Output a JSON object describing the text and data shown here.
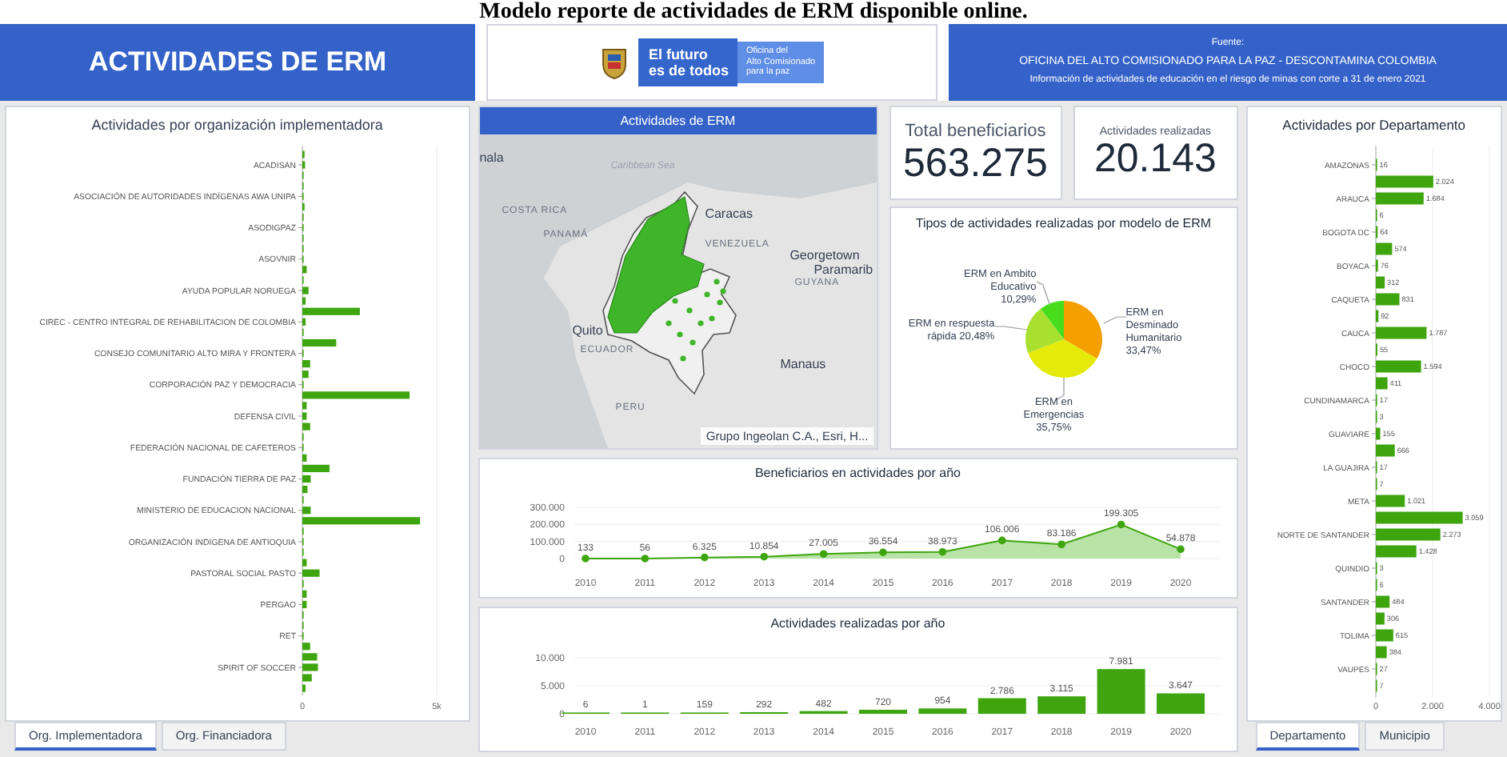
{
  "caption": "Modelo reporte de actividades de ERM disponible online.",
  "header": {
    "title": "ACTIVIDADES DE ERM",
    "logo_texts": [
      "El futuro\nes de todos",
      "Oficina del\nAlto Comisionado\npara la paz"
    ],
    "source": [
      "Fuente:",
      "OFICINA DEL ALTO COMISIONADO PARA LA PAZ - DESCONTAMINA COLOMBIA",
      "Información de actividades de educación en el riesgo de minas con corte a 31 de enero 2021"
    ]
  },
  "org_panel": {
    "title": "Actividades por organización implementadora",
    "chart_data": {
      "type": "bar",
      "orientation": "horizontal",
      "values": [
        80,
        100,
        40,
        40,
        40,
        80,
        20,
        40,
        20,
        20,
        20,
        160,
        20,
        230,
        120,
        2140,
        120,
        40,
        1260,
        40,
        290,
        230,
        40,
        3990,
        160,
        160,
        290,
        20,
        20,
        160,
        1010,
        310,
        190,
        20,
        310,
        4380,
        20,
        40,
        20,
        160,
        640,
        20,
        160,
        160,
        20,
        20,
        20,
        290,
        550,
        580,
        350,
        120
      ],
      "categories": [
        null,
        "ACADISAN",
        null,
        null,
        "ASOCIACIÓN DE AUTORIDADES INDÍGENAS AWA UNIPA",
        null,
        null,
        "ASODIGPAZ",
        null,
        null,
        "ASOVNIR",
        null,
        null,
        "AYUDA POPULAR NORUEGA",
        null,
        null,
        "CIREC - CENTRO INTEGRAL DE REHABILITACION DE COLOMBIA",
        null,
        null,
        "CONSEJO COMUNITARIO ALTO MIRA Y FRONTERA",
        null,
        null,
        "CORPORACIÓN PAZ Y DEMOCRACIA",
        null,
        null,
        "DEFENSA CIVIL",
        null,
        null,
        "FEDERACIÓN NACIONAL DE CAFETEROS",
        null,
        null,
        "FUNDACIÓN TIERRA DE PAZ",
        null,
        null,
        "MINISTERIO DE EDUCACION NACIONAL",
        null,
        null,
        "ORGANIZACIÓN INDIGENA DE ANTIOQUIA",
        null,
        null,
        "PASTORAL SOCIAL PASTO",
        null,
        null,
        "PERGAO",
        null,
        null,
        "RET",
        null,
        null,
        "SPIRIT OF SOCCER",
        null,
        null
      ],
      "xlim": [
        0,
        5000
      ],
      "xticks": [
        {
          "value": 0,
          "label": "0"
        },
        {
          "value": 5000,
          "label": "5k"
        }
      ]
    },
    "tabs": [
      {
        "label": "Org. Implementadora",
        "selected": true
      },
      {
        "label": "Org. Financiadora",
        "selected": false
      }
    ]
  },
  "map": {
    "title": "Actividades de ERM",
    "labels": [
      {
        "text": "nala",
        "kind": "city"
      },
      {
        "text": "Caribbean Sea",
        "kind": "sea"
      },
      {
        "text": "COSTA RICA",
        "kind": "country"
      },
      {
        "text": "PANAMÁ",
        "kind": "country"
      },
      {
        "text": "Caracas",
        "kind": "city"
      },
      {
        "text": "VENEZUELA",
        "kind": "country"
      },
      {
        "text": "Georgetown",
        "kind": "city"
      },
      {
        "text": "Paramarib",
        "kind": "city"
      },
      {
        "text": "GUYANA",
        "kind": "country"
      },
      {
        "text": "Quito",
        "kind": "city"
      },
      {
        "text": "ECUADOR",
        "kind": "country"
      },
      {
        "text": "Manaus",
        "kind": "city"
      },
      {
        "text": "PERU",
        "kind": "country"
      }
    ],
    "attribution": "Grupo Ingeolan C.A., Esri, H..."
  },
  "totals": [
    {
      "label": "Total beneficiarios",
      "value": "563.275"
    },
    {
      "label": "Actividades realizadas",
      "value": "20.143"
    }
  ],
  "pie": {
    "title": "Tipos de actividades realizadas por modelo de ERM",
    "chart_data": {
      "type": "pie",
      "categories": [
        "ERM en Desminado Humanitario",
        "ERM en Emergencias",
        "ERM en respuesta rápida",
        "ERM en Ambito Educativo"
      ],
      "values": [
        33.47,
        35.75,
        20.48,
        10.29
      ],
      "colors": [
        "#f5a000",
        "#e6ea0a",
        "#a8e030",
        "#47dc1c"
      ],
      "value_labels": [
        "33,47%",
        "35,75%",
        "20,48%",
        "10,29%"
      ]
    }
  },
  "beneficiaries": {
    "title": "Beneficiarios en actividades por año",
    "chart_data": {
      "type": "area",
      "x": [
        "2010",
        "2011",
        "2012",
        "2013",
        "2014",
        "2015",
        "2016",
        "2017",
        "2018",
        "2019",
        "2020"
      ],
      "values": [
        133,
        56,
        6325,
        10854,
        27005,
        36554,
        38973,
        106006,
        83186,
        199305,
        54878
      ],
      "value_labels": [
        "133",
        "56",
        "6.325",
        "10.854",
        "27.005",
        "36.554",
        "38.973",
        "106.006",
        "83.186",
        "199.305",
        "54.878"
      ],
      "ylim": [
        0,
        300000
      ],
      "yticks": [
        {
          "value": 0,
          "label": "0"
        },
        {
          "value": 100000,
          "label": "100.000"
        },
        {
          "value": 200000,
          "label": "200.000"
        },
        {
          "value": 300000,
          "label": "300.000"
        }
      ]
    }
  },
  "activities": {
    "title": "Actividades realizadas por año",
    "chart_data": {
      "type": "bar",
      "categories": [
        "2010",
        "2011",
        "2012",
        "2013",
        "2014",
        "2015",
        "2016",
        "2017",
        "2018",
        "2019",
        "2020"
      ],
      "values": [
        6,
        1,
        159,
        292,
        482,
        720,
        954,
        2786,
        3115,
        7981,
        3647
      ],
      "value_labels": [
        "6",
        "1",
        "159",
        "292",
        "482",
        "720",
        "954",
        "2.786",
        "3.115",
        "7.981",
        "3.647"
      ],
      "ylim": [
        0,
        10000
      ],
      "yticks": [
        {
          "value": 0,
          "label": "0"
        },
        {
          "value": 5000,
          "label": "5.000"
        },
        {
          "value": 10000,
          "label": "10.000"
        }
      ]
    }
  },
  "dept_panel": {
    "title": "Actividades por Departamento",
    "chart_data": {
      "type": "bar",
      "orientation": "horizontal",
      "values": [
        16,
        2024,
        1684,
        6,
        64,
        574,
        76,
        312,
        831,
        92,
        1787,
        55,
        1594,
        411,
        17,
        3,
        155,
        666,
        17,
        7,
        1021,
        3059,
        2273,
        1428,
        3,
        6,
        484,
        306,
        615,
        384,
        27,
        7
      ],
      "value_labels": [
        "16",
        "2.024",
        "1.684",
        "6",
        "64",
        "574",
        "76",
        "312",
        "831",
        "92",
        "1.787",
        "55",
        "1.594",
        "411",
        "17",
        "3",
        "155",
        "666",
        "17",
        "7",
        "1.021",
        "3.059",
        "2.273",
        "1.428",
        "3",
        "6",
        "484",
        "306",
        "615",
        "384",
        "27",
        "7"
      ],
      "categories": [
        "AMAZONAS",
        null,
        "ARAUCA",
        null,
        "BOGOTA DC",
        null,
        "BOYACA",
        null,
        "CAQUETA",
        null,
        "CAUCA",
        null,
        "CHOCO",
        null,
        "CUNDINAMARCA",
        null,
        "GUAVIARE",
        null,
        "LA GUAJIRA",
        null,
        "META",
        null,
        "NORTE DE SANTANDER",
        null,
        "QUINDIO",
        null,
        "SANTANDER",
        null,
        "TOLIMA",
        null,
        "VAUPES",
        null
      ],
      "xlim": [
        0,
        4000
      ],
      "xticks": [
        {
          "value": 0,
          "label": "0"
        },
        {
          "value": 2000,
          "label": "2.000"
        },
        {
          "value": 4000,
          "label": "4.000"
        }
      ]
    },
    "tabs": [
      {
        "label": "Departamento",
        "selected": true
      },
      {
        "label": "Municipio",
        "selected": false
      }
    ]
  }
}
